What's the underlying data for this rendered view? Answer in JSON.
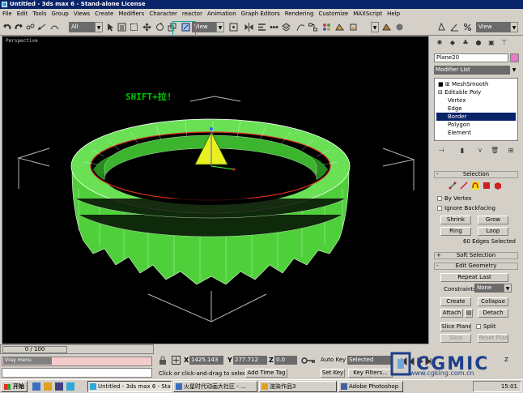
{
  "window": {
    "title": "Untitled - 3ds max 6 - Stand-alone License"
  },
  "menu": [
    "File",
    "Edit",
    "Tools",
    "Group",
    "Views",
    "Create",
    "Modifiers",
    "Character",
    "reactor",
    "Animation",
    "Graph Editors",
    "Rendering",
    "Customize",
    "MAXScript",
    "Help"
  ],
  "toolbar": {
    "selection_filter": "All",
    "coord_system": "View",
    "view_right": "View"
  },
  "viewport": {
    "label": "Perspective",
    "annotation": "SHIFT+拉!"
  },
  "command_panel": {
    "object_name": "Plane20",
    "object_color": "#e87ac8",
    "modifier_list": "Modifier List",
    "stack": [
      "MeshSmooth",
      "Editable Poly",
      "Vertex",
      "Edge",
      "Border",
      "Polygon",
      "Element"
    ],
    "stack_selected": "Border",
    "selection": {
      "title": "Selection",
      "by_vertex": "By Vertex",
      "ignore_backfacing": "Ignore Backfacing",
      "shrink": "Shrink",
      "grow": "Grow",
      "ring": "Ring",
      "loop": "Loop",
      "info": "60 Edges Selected"
    },
    "soft_selection": "Soft Selection",
    "edit_geometry": {
      "title": "Edit Geometry",
      "repeat_last": "Repeat Last",
      "constraints_label": "Constraints:",
      "constraints_value": "None",
      "create": "Create",
      "collapse": "Collapse",
      "attach": "Attach",
      "detach": "Detach",
      "slice_plane": "Slice Plane",
      "split": "Split",
      "slice": "Slice",
      "reset_plane": "Reset Plane"
    }
  },
  "status": {
    "time_slider": "0 / 100",
    "x_label": "X",
    "x_value": "1425.143",
    "y_label": "Y",
    "y_value": "277.712",
    "z_label": "Z",
    "z_value": "0.0",
    "prompt": "Click or click-and-drag to select obj",
    "add_time_tag": "Add Time Tag",
    "auto_key": "Auto Key",
    "set_key": "Set Key",
    "selected": "Selected",
    "key_filters": "Key Filters...",
    "zoom_hint": "Z"
  },
  "taskbar": {
    "start": "开始",
    "tasks": [
      "Untitled - 3ds max 6 - Sta...",
      "火星时代动画大社区 - ...",
      "渲染作品3",
      "Adobe Photoshop"
    ],
    "tray_hint": "Vray menu",
    "clock": "15:01"
  },
  "watermark": {
    "brand": "CGMIC",
    "url": "www.cgking.com.cn"
  }
}
